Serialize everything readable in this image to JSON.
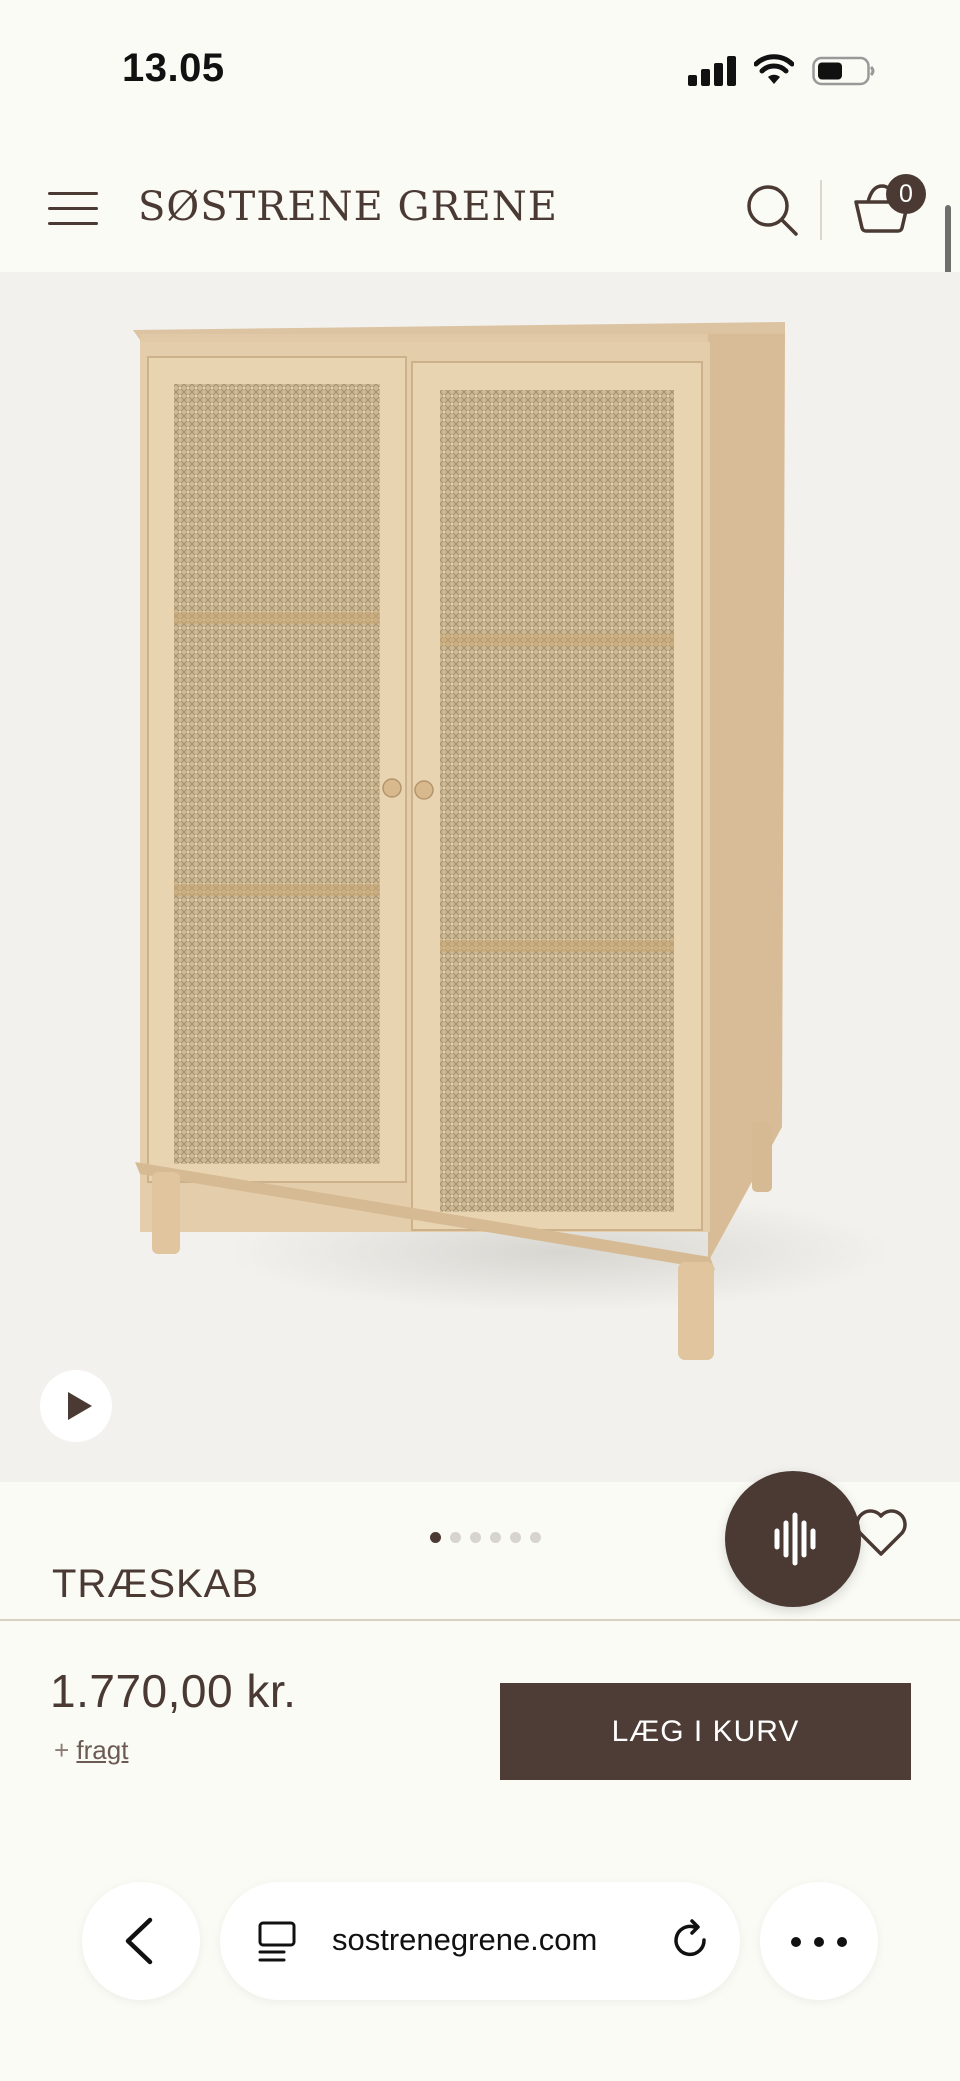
{
  "status_bar": {
    "time": "13.05"
  },
  "header": {
    "logo": "SØSTRENE GRENE",
    "basket_count": "0"
  },
  "carousel": {
    "total": 6,
    "active": 1
  },
  "product": {
    "title": "TRÆSKAB",
    "price": "1.770,00 kr.",
    "shipping_prefix": "+",
    "shipping_link": "fragt",
    "add_to_cart_label": "LÆG I KURV"
  },
  "browser": {
    "url": "sostrenegrene.com"
  },
  "colors": {
    "brand_brown": "#4a3a33",
    "background": "#fbfbf6",
    "image_bg": "#f2f1ed"
  }
}
